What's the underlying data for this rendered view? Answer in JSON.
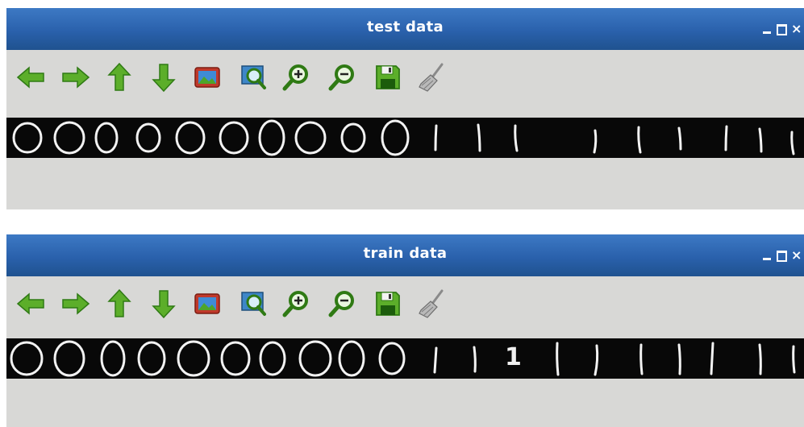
{
  "windows": [
    {
      "id": "test",
      "title": "test data"
    },
    {
      "id": "train",
      "title": "train data"
    }
  ],
  "toolbar_icons": [
    "arrow-left-icon",
    "arrow-right-icon",
    "arrow-up-icon",
    "arrow-down-icon",
    "image-icon",
    "zoom-fit-icon",
    "zoom-in-icon",
    "zoom-out-icon",
    "save-icon",
    "clear-brush-icon"
  ],
  "train_strip": {
    "digit_label": "1"
  },
  "colors": {
    "titlebar": "#2a61ac",
    "window_bg": "#d8d8d6",
    "strip_bg": "#080808",
    "icon_green": "#5cae2a"
  }
}
